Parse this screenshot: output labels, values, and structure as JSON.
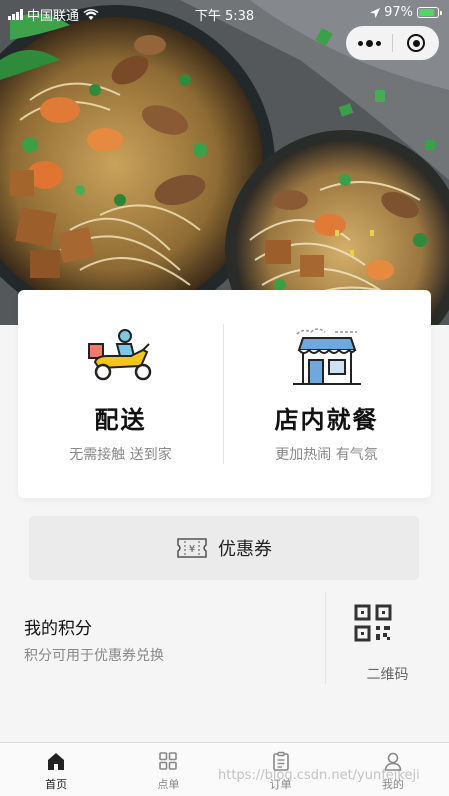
{
  "status_bar": {
    "carrier": "中国联通",
    "time": "下午 5:38",
    "battery": "97%"
  },
  "hero": {
    "image": "noodle-soup-bowls-photo"
  },
  "capsule": {
    "more_icon": "more-dots-icon",
    "close_icon": "target-close-icon"
  },
  "services": [
    {
      "title": "配送",
      "subtitle": "无需接触 送到家",
      "icon": "scooter-delivery-icon"
    },
    {
      "title": "店内就餐",
      "subtitle": "更加热闹 有气氛",
      "icon": "storefront-icon"
    }
  ],
  "coupon": {
    "label": "优惠券",
    "icon": "ticket-yen-icon"
  },
  "points": {
    "title": "我的积分",
    "description": "积分可用于优惠券兑换",
    "qr_label": "二维码",
    "qr_icon": "qr-code-icon"
  },
  "tabbar": {
    "items": [
      {
        "label": "首页",
        "icon": "home-icon",
        "active": true
      },
      {
        "label": "点单",
        "icon": "grid-icon",
        "active": false
      },
      {
        "label": "订单",
        "icon": "clipboard-icon",
        "active": false
      },
      {
        "label": "我的",
        "icon": "user-icon",
        "active": false
      }
    ]
  },
  "watermark": "https://blog.csdn.net/yunfeikeji",
  "colors": {
    "accent_yellow": "#f5c518",
    "text_primary": "#111111",
    "text_secondary": "#888888",
    "page_bg": "#f5f5f5"
  }
}
